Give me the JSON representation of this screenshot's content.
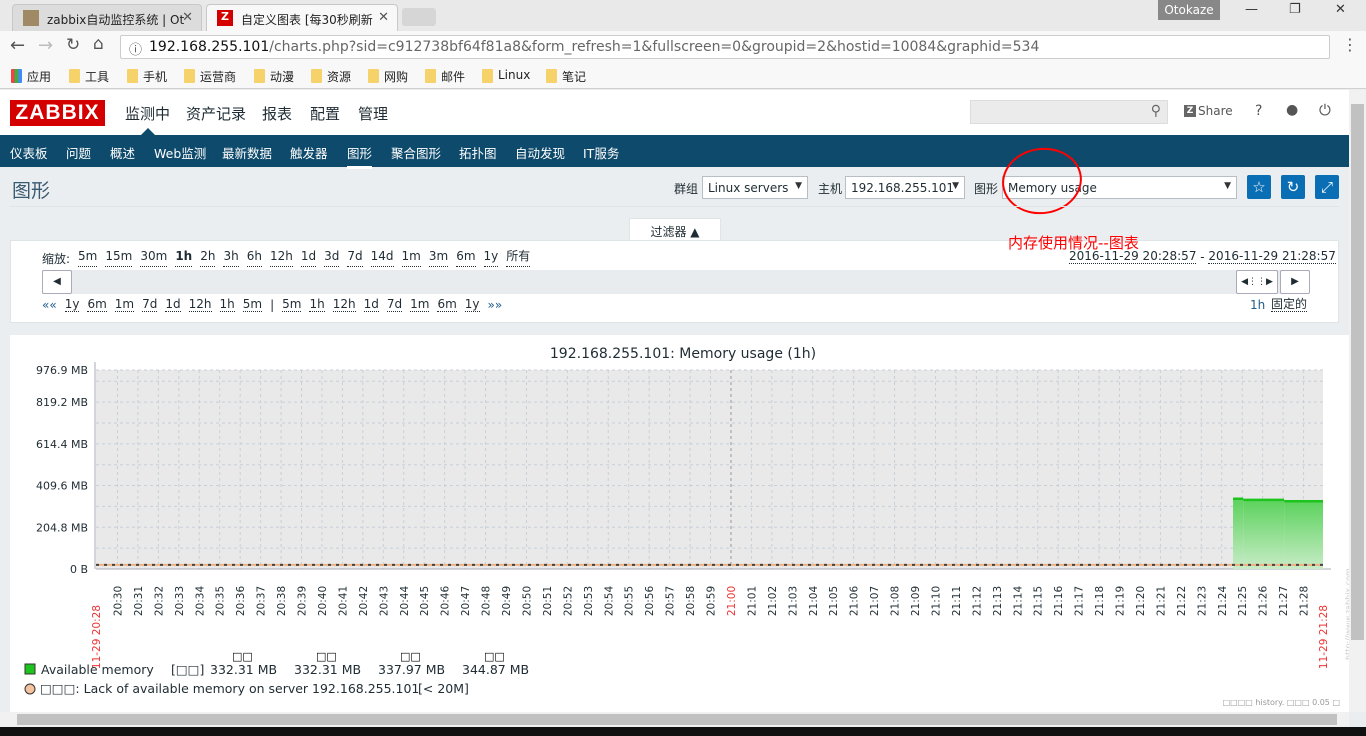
{
  "browser": {
    "tabs": [
      {
        "title": "zabbix自动监控系统 | Ot"
      },
      {
        "title": "自定义图表 [每30秒刷新"
      }
    ],
    "user": "Otokaze",
    "url_host": "192.168.255.101",
    "url_path": "/charts.php?sid=c912738bf64f81a8&form_refresh=1&fullscreen=0&groupid=2&hostid=10084&graphid=534",
    "bookmarks": [
      "应用",
      "工具",
      "手机",
      "运营商",
      "动漫",
      "资源",
      "网购",
      "邮件",
      "Linux",
      "笔记"
    ]
  },
  "header": {
    "logo": "ZABBIX",
    "menu": [
      "监测中",
      "资产记录",
      "报表",
      "配置",
      "管理"
    ],
    "share": "Share",
    "help": "?"
  },
  "nav": [
    "仪表板",
    "问题",
    "概述",
    "Web监测",
    "最新数据",
    "触发器",
    "图形",
    "聚合图形",
    "拓扑图",
    "自动发现",
    "IT服务"
  ],
  "page": {
    "title": "图形",
    "group_label": "群组",
    "group_value": "Linux servers",
    "host_label": "主机",
    "host_value": "192.168.255.101",
    "graph_label": "图形",
    "graph_value": "Memory usage",
    "annotation": "内存使用情况--图表"
  },
  "filter": {
    "tab_label": "过滤器 ▲",
    "zoom_label": "缩放:",
    "zoom_options": [
      "5m",
      "15m",
      "30m",
      "1h",
      "2h",
      "3h",
      "6h",
      "12h",
      "1d",
      "3d",
      "7d",
      "14d",
      "1m",
      "3m",
      "6m",
      "1y",
      "所有"
    ],
    "zoom_active": "1h",
    "nav_back": [
      "««",
      "1y",
      "6m",
      "1m",
      "7d",
      "1d",
      "12h",
      "1h",
      "5m"
    ],
    "nav_sep": "|",
    "nav_fwd": [
      "5m",
      "1h",
      "12h",
      "1d",
      "7d",
      "1m",
      "6m",
      "1y",
      "»»"
    ],
    "from": "2016-11-29 20:28:57",
    "to": "2016-11-29 21:28:57",
    "dash": " - ",
    "period": "1h",
    "fixed": "固定的"
  },
  "chart_data": {
    "type": "area",
    "title": "192.168.255.101: Memory usage (1h)",
    "y_ticks": [
      "976.9 MB",
      "819.2 MB",
      "614.4 MB",
      "409.6 MB",
      "204.8 MB",
      "0 B"
    ],
    "ylim": [
      0,
      976.9
    ],
    "y_unit": "MB",
    "xlim": [
      "20:28:57",
      "21:28:57"
    ],
    "x_start_label": "11-29 20:28",
    "x_end_label": "11-29 21:28",
    "x_mid_label": "21:00",
    "grid": true,
    "series": [
      {
        "name": "Available memory",
        "color": "#1ec41e",
        "points": [
          [
            "21:24:33",
            344.87
          ],
          [
            "21:25:03",
            339.5
          ],
          [
            "21:27:03",
            332.31
          ],
          [
            "21:28:57",
            332.31
          ]
        ]
      }
    ],
    "trigger": {
      "value": 20,
      "color": "#f0b080"
    },
    "legend": {
      "headers": [
        "□□",
        "□□",
        "□□",
        "□□"
      ],
      "item1": "Available memory",
      "func": "[□□]",
      "last": "332.31 MB",
      "min": "332.31 MB",
      "avg": "337.97 MB",
      "max": "344.87 MB",
      "item2": "□□□: Lack of available memory on server 192.168.255.101",
      "item2_cond": "[< 20M]"
    },
    "watermark": "http://www.zabbix.com",
    "footer_note": "□□□□ history. □□□ 0.05 □"
  }
}
